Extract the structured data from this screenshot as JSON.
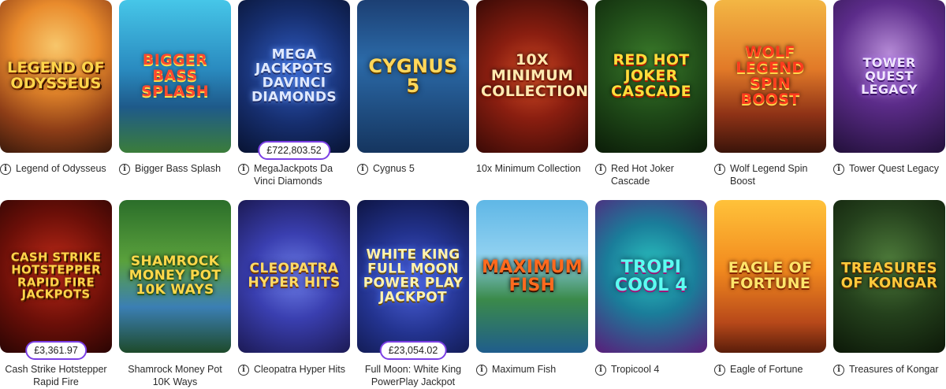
{
  "games_row1": [
    {
      "thumb_title": "LEGEND of ODYSSEUS",
      "caption": "Legend of Odysseus",
      "jackpot": ""
    },
    {
      "thumb_title": "BIGGER BASS SPLASH",
      "caption": "Bigger Bass Splash",
      "jackpot": ""
    },
    {
      "thumb_title": "MEGA JACKPOTS DAVINCI DIAMONDS",
      "caption": "MegaJackpots Da Vinci Diamonds",
      "jackpot": "£722,803.52"
    },
    {
      "thumb_title": "CYGNUS 5",
      "caption": "Cygnus 5",
      "jackpot": ""
    },
    {
      "thumb_title": "10x MINIMUM COLLECTION",
      "caption": "10x Minimum Collection",
      "jackpot": ""
    },
    {
      "thumb_title": "RED HOT JOKER CASCADE",
      "caption": "Red Hot Joker Cascade",
      "jackpot": ""
    },
    {
      "thumb_title": "WOLF LEGEND SPIN BOOST",
      "caption": "Wolf Legend Spin Boost",
      "jackpot": ""
    },
    {
      "thumb_title": "TOWER QUEST LEGACY",
      "caption": "Tower Quest Legacy",
      "jackpot": ""
    }
  ],
  "games_row2": [
    {
      "thumb_title": "CASH STRIKE HOTSTEPPER RAPID FIRE JACKPOTS",
      "caption": "Cash Strike Hotstepper Rapid Fire",
      "jackpot": "£3,361.97"
    },
    {
      "thumb_title": "SHAMROCK MONEY POT 10K WAYS",
      "caption": "Shamrock Money Pot 10K Ways",
      "jackpot": ""
    },
    {
      "thumb_title": "CLEOPATRA HYPER HITS",
      "caption": "Cleopatra Hyper Hits",
      "jackpot": ""
    },
    {
      "thumb_title": "WHITE KING FULL MOON POWER PLAY JACKPOT",
      "caption": "Full Moon: White King PowerPlay Jackpot",
      "jackpot": "£23,054.02"
    },
    {
      "thumb_title": "MAXIMUM FISH",
      "caption": "Maximum Fish",
      "jackpot": ""
    },
    {
      "thumb_title": "TROPI COOL 4",
      "caption": "Tropicool 4",
      "jackpot": ""
    },
    {
      "thumb_title": "EAGLE of FORTUNE",
      "caption": "Eagle of Fortune",
      "jackpot": ""
    },
    {
      "thumb_title": "TREASURES of KONGAR",
      "caption": "Treasures of Kongar",
      "jackpot": ""
    }
  ],
  "info_icon": "info-circle-icon",
  "colors": {
    "jackpot_border": "#7b3fe4",
    "text": "#2b2b2b",
    "background": "#ffffff"
  }
}
